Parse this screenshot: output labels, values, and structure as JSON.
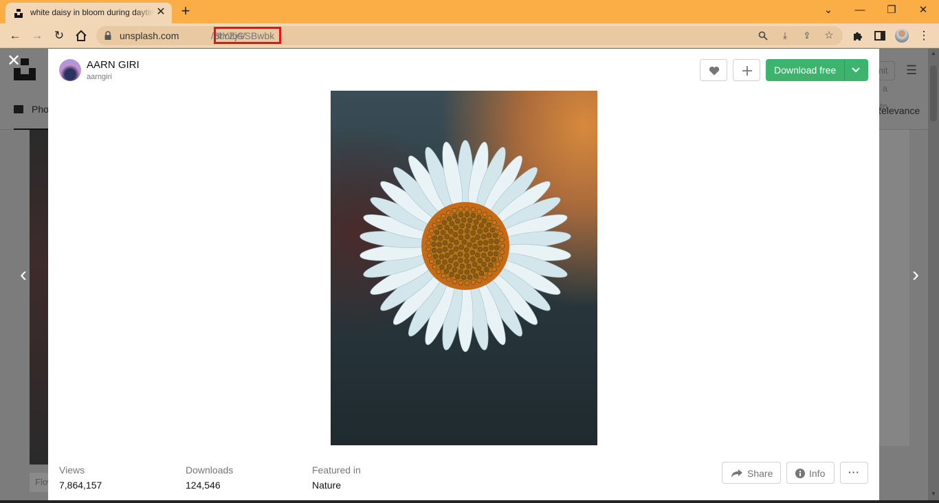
{
  "browser": {
    "tab_title": "white daisy in bloom during daytime photo – Free Flower Image on Unsplash",
    "url_host": "unsplash.com",
    "url_path": "/photos/",
    "url_id": "8tYZjGSBwbk",
    "accent_color": "#fbae45",
    "highlight_color": "#e0141e"
  },
  "background_page": {
    "photos_tab": "Photos",
    "sort_label": "Relevance",
    "submit_label": "Submit a photo",
    "left_card_label": "Flower"
  },
  "modal": {
    "author": {
      "name": "AARN GIRI",
      "handle": "aarngiri"
    },
    "download_label": "Download free",
    "photo_alt": "white daisy in bloom during daytime",
    "stats": {
      "views_label": "Views",
      "views_value": "7,864,157",
      "downloads_label": "Downloads",
      "downloads_value": "124,546",
      "featured_label": "Featured in",
      "featured_value": "Nature"
    },
    "actions": {
      "share_label": "Share",
      "info_label": "Info",
      "more_label": "···"
    },
    "brand_color": "#3cb46e"
  }
}
